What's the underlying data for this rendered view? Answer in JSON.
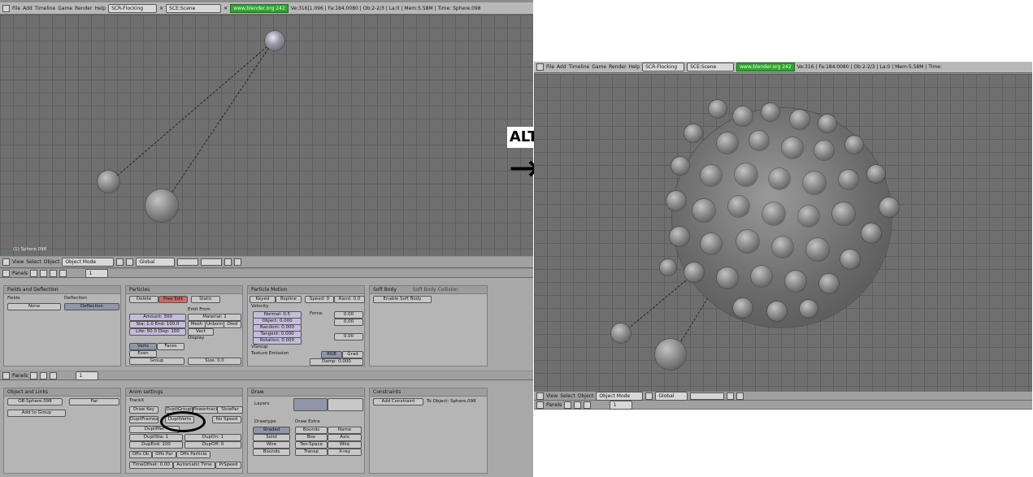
{
  "left": {
    "menu": [
      "File",
      "Add",
      "Timeline",
      "Game",
      "Render",
      "Help"
    ],
    "scene_field": "SCR-Flocking",
    "scene2_field": "SCE:Scene",
    "url_badge": "www.blender.org 242",
    "stats": "Ve:316|1.096 | Fa:184.0080 | Ob:2-2/3 | La:0 | Mem:5.58M | Time: Sphere.098",
    "object_label": "(1) Sphere.098",
    "view_header": {
      "menu": [
        "View",
        "Select",
        "Object"
      ],
      "mode": "Object Mode",
      "field": "Global"
    },
    "panels_header": {
      "label": "Panels",
      "frame": "1"
    },
    "panels_header2": {
      "label": "Panels",
      "frame": "1"
    },
    "panels_row1": {
      "fields_deflection": {
        "title": "Fields and Deflection",
        "fields_label": "Fields",
        "fields_value": "None",
        "deflection_label": "Deflection",
        "deflection_btn": "Deflection"
      },
      "particles": {
        "title": "Particles",
        "delete": "Delete",
        "free_edit": "Free Edit",
        "static": "Static",
        "left_fields": [
          "Amount: 300",
          "Sta: 1.0  End: 100.0",
          "Life: 50.0  Disp: 100"
        ],
        "emit_from": "Emit From",
        "right_fields": [
          "Verts",
          "Faces",
          "Even"
        ],
        "group": "Group",
        "display": "Display",
        "mat": "Material: 1",
        "btns": [
          "Mesh",
          "Unborn",
          "Died"
        ],
        "vect": "Vect",
        "size": "Size: 0.0"
      },
      "particle_motion": {
        "title": "Particle Motion",
        "buttons": [
          "Keyed",
          "Bspline",
          "Speed: 0",
          "Rand: 0.0"
        ],
        "velocity": "Velocity",
        "vfields": [
          "Normal: 0.5",
          "Object: 0.000",
          "Random: 0.000",
          "Tangent: 0.000",
          "Rotation: 0.000"
        ],
        "vgroup": "VGroup",
        "texture_emission": "Texture Emission",
        "tex": [
          "RGB",
          "Grad"
        ],
        "force": "Force:",
        "grid": [
          "0.00",
          "0.00",
          "0.00"
        ],
        "damp": "Damp: 0.000"
      },
      "soft_body": {
        "tab1": "Soft Body",
        "tab2": "Soft Body Collision",
        "btn": "Enable Soft Body"
      }
    },
    "panels_row2": {
      "object_and_links": {
        "title": "Object and Links",
        "ob_field": "OB:Sphere.098",
        "par_field": "Par",
        "add_group": "Add to Group"
      },
      "anim_settings": {
        "title": "Anim settings",
        "track_label": "TrackX",
        "buttons": [
          "Draw Key",
          "DupliVerts",
          "DupliFrames",
          "Powertrack",
          "SlowPar",
          "DupliGroup",
          "No Speed",
          "DupliMet",
          "DupliSta: 1",
          "DupOn: 1",
          "DupEnd: 100",
          "DupOff: 0",
          "Offs Ob",
          "Offs Par",
          "Offs Particle",
          "TimeOffset: 0.00",
          "Automatic Time",
          "PrSpeed"
        ]
      },
      "draw": {
        "title": "Draw",
        "layers": "Layers",
        "drawtype": "Drawtype",
        "draw_extra": "Draw Extra",
        "dt_buttons": [
          "Shaded",
          "Solid",
          "Wire",
          "Bounds"
        ],
        "extra_buttons": [
          "Bounds",
          "Name",
          "Axis",
          "Tex-Space",
          "Wire",
          "Transp",
          "X-ray"
        ],
        "box_type": "Box"
      },
      "constraints": {
        "title": "Constraints",
        "add_btn": "Add Constraint",
        "to_label": "To Object: Sphere.098"
      }
    }
  },
  "arrow": {
    "label": "ALT + A",
    "glyph": "→"
  },
  "right": {
    "menu": [
      "File",
      "Add",
      "Timeline",
      "Game",
      "Render",
      "Help"
    ],
    "scene_field": "SCR-Flocking",
    "scene2_field": "SCE:Scene",
    "url_badge": "www.blender.org 242",
    "stats": "Ve:316 | Fa:184.0080 | Ob:2-2/3 | La:0 | Mem:5.58M | Time:",
    "view_header": {
      "menu": [
        "View",
        "Select",
        "Object"
      ],
      "mode": "Object Mode",
      "field": "Global"
    },
    "panels_header": {
      "label": "Panels",
      "frame": "1"
    }
  }
}
